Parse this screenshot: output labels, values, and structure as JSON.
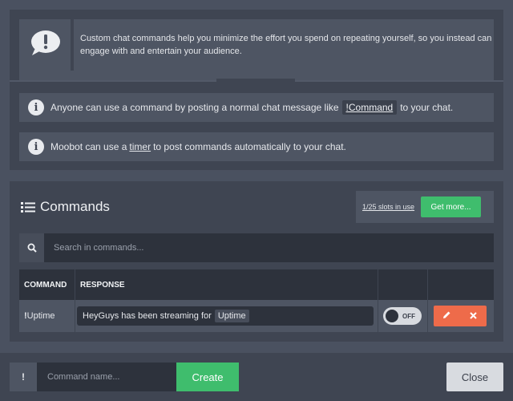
{
  "intro": {
    "description": "Custom chat commands help you minimize the effort you spend on repeating yourself, so you instead can engage with and entertain your audience."
  },
  "info": [
    {
      "before": "Anyone can use a command by posting a normal chat message like",
      "chip": "!Command",
      "after": "to your chat."
    },
    {
      "before": "Moobot can use a",
      "link": "timer",
      "after": "to post commands automatically to your chat."
    }
  ],
  "commands_panel": {
    "title": "Commands",
    "slots_label": "1/25 slots in use",
    "get_more_label": "Get more...",
    "search_placeholder": "Search in commands..."
  },
  "table": {
    "headers": {
      "command": "COMMAND",
      "response": "RESPONSE"
    },
    "rows": [
      {
        "command_prefix": "!",
        "command": "Uptime",
        "response_text": "HeyGuys has been streaming for",
        "response_var": "Uptime",
        "toggle_label": "OFF",
        "toggle_on": false
      }
    ]
  },
  "footer": {
    "prefix": "!",
    "name_placeholder": "Command name...",
    "create_label": "Create",
    "close_label": "Close"
  },
  "colors": {
    "accent_green": "#3fbd6d",
    "danger_orange": "#ee6b4a",
    "background": "#4a5160",
    "panel": "#3f4552"
  },
  "icons": [
    "chat-alert-icon",
    "info-icon",
    "list-icon",
    "search-icon",
    "pencil-icon",
    "close-icon"
  ]
}
